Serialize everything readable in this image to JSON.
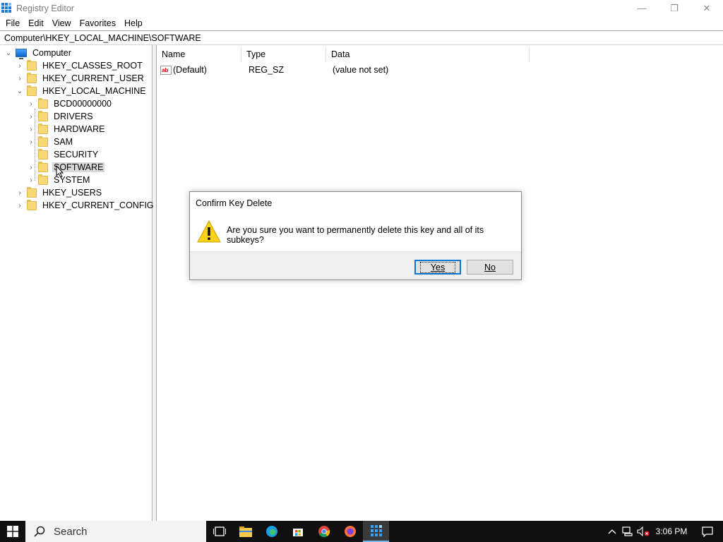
{
  "window": {
    "title": "Registry Editor",
    "minimize_glyph": "—",
    "restore_glyph": "❐",
    "close_glyph": "✕"
  },
  "menu": [
    "File",
    "Edit",
    "View",
    "Favorites",
    "Help"
  ],
  "address": "Computer\\HKEY_LOCAL_MACHINE\\SOFTWARE",
  "tree": {
    "root": "Computer",
    "hives": {
      "classes_root": "HKEY_CLASSES_ROOT",
      "current_user": "HKEY_CURRENT_USER",
      "local_machine": "HKEY_LOCAL_MACHINE",
      "users": "HKEY_USERS",
      "current_config": "HKEY_CURRENT_CONFIG"
    },
    "hklm_children": [
      "BCD00000000",
      "DRIVERS",
      "HARDWARE",
      "SAM",
      "SECURITY",
      "SOFTWARE",
      "SYSTEM"
    ],
    "selected": "SOFTWARE"
  },
  "list": {
    "columns": [
      "Name",
      "Type",
      "Data"
    ],
    "rows": [
      {
        "icon": "ab",
        "name": "(Default)",
        "type": "REG_SZ",
        "data": "(value not set)"
      }
    ]
  },
  "dialog": {
    "title": "Confirm Key Delete",
    "message": "Are you sure you want to permanently delete this key and all of its subkeys?",
    "yes_label": "Yes",
    "no_label": "No",
    "icon": "warning-icon"
  },
  "taskbar": {
    "search_placeholder": "Search",
    "time": "3:06 PM",
    "accent": "#0078d7"
  }
}
